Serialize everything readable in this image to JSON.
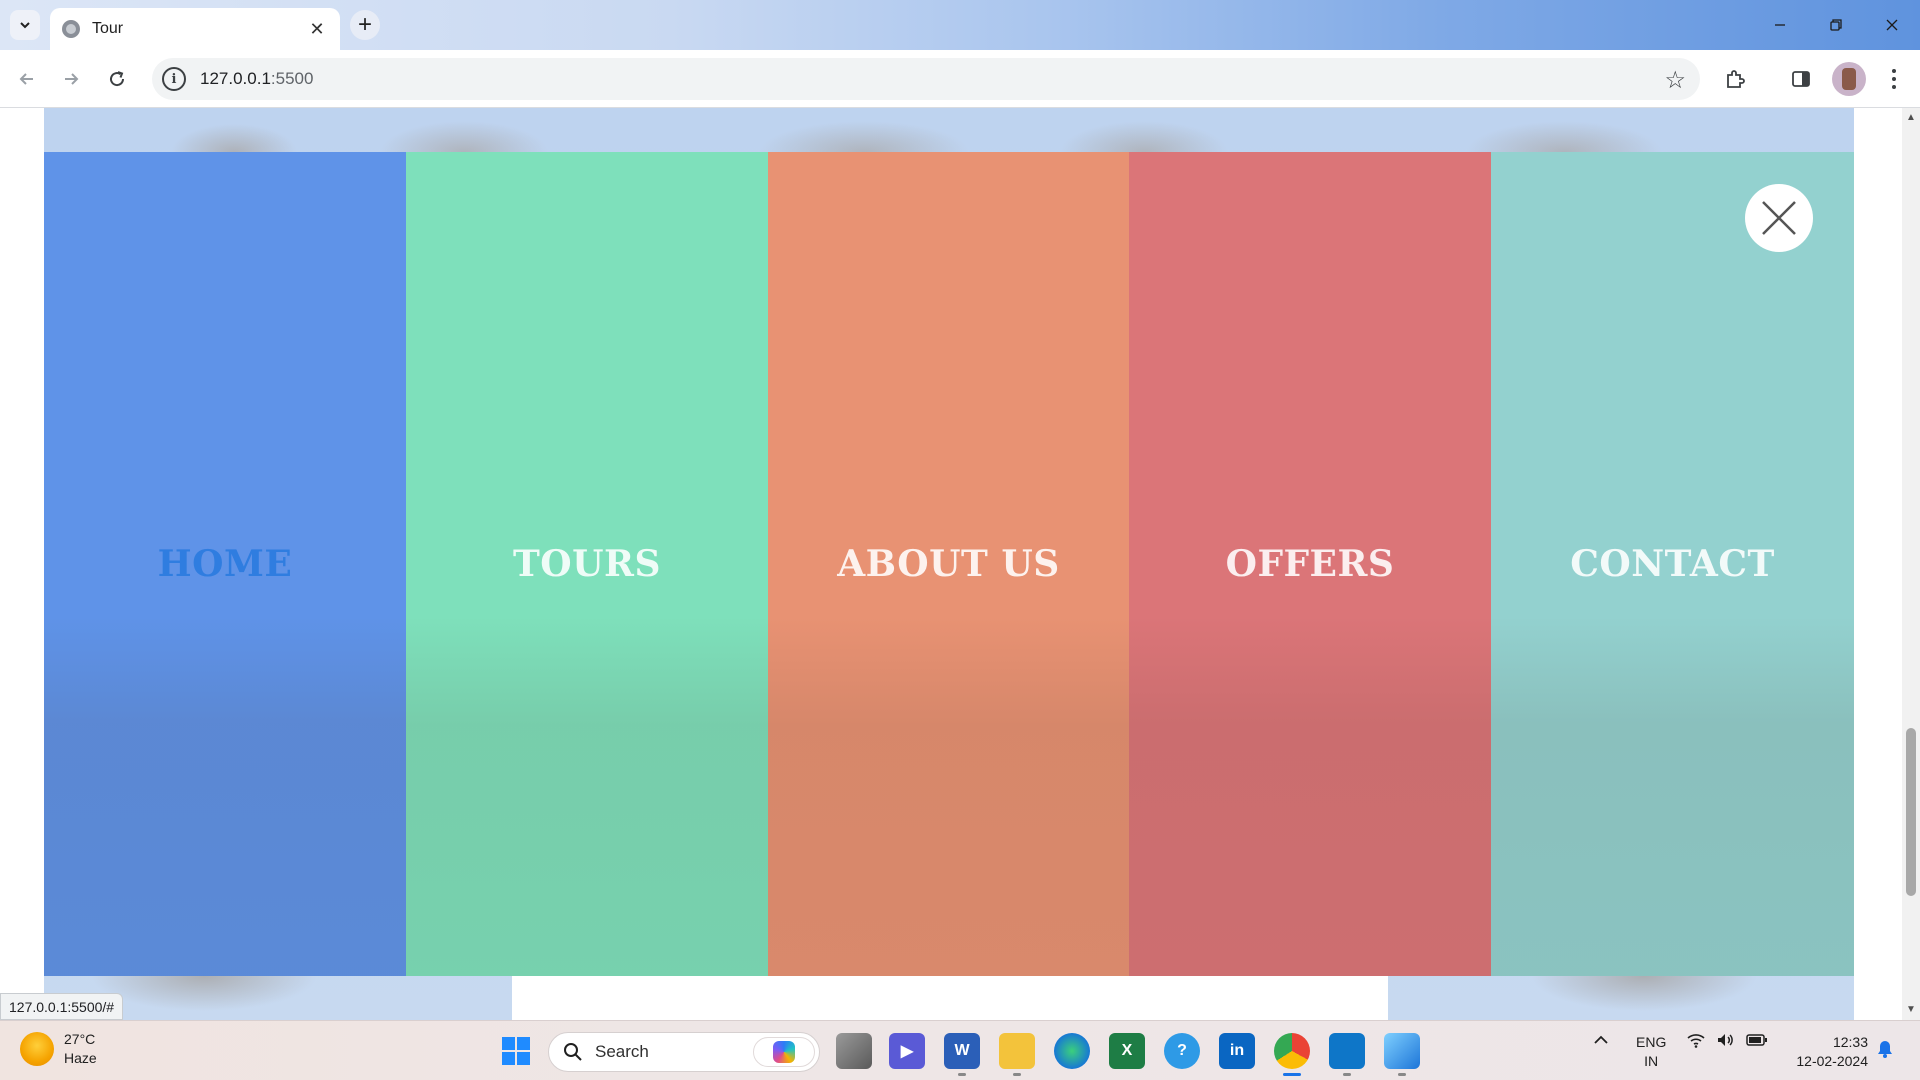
{
  "browser": {
    "tab_title": "Tour",
    "url_host": "127.0.0.1",
    "url_port": ":5500",
    "status_link": "127.0.0.1:5500/#"
  },
  "menu": {
    "items": [
      {
        "label": "HOME",
        "color": "#5f93e8",
        "active": true
      },
      {
        "label": "TOURS",
        "color": "#7ee0bb"
      },
      {
        "label": "ABOUT US",
        "color": "#e89273"
      },
      {
        "label": "OFFERS",
        "color": "#db7578"
      },
      {
        "label": "CONTACT",
        "color": "#93d1cf"
      }
    ],
    "active_color": "#2f7de0",
    "close_icon": "close-icon"
  },
  "taskbar": {
    "weather_temp": "27°C",
    "weather_desc": "Haze",
    "search_placeholder": "Search",
    "lang_top": "ENG",
    "lang_bottom": "IN",
    "time": "12:33",
    "date": "12-02-2024"
  }
}
